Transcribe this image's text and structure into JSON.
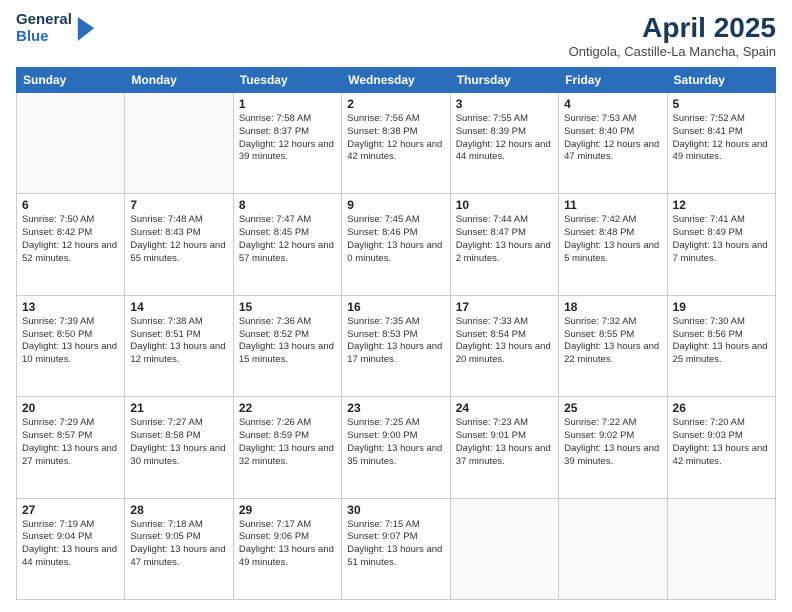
{
  "logo": {
    "line1": "General",
    "line2": "Blue"
  },
  "title": "April 2025",
  "subtitle": "Ontigola, Castille-La Mancha, Spain",
  "headers": [
    "Sunday",
    "Monday",
    "Tuesday",
    "Wednesday",
    "Thursday",
    "Friday",
    "Saturday"
  ],
  "weeks": [
    [
      {
        "day": "",
        "detail": ""
      },
      {
        "day": "",
        "detail": ""
      },
      {
        "day": "1",
        "detail": "Sunrise: 7:58 AM\nSunset: 8:37 PM\nDaylight: 12 hours and 39 minutes."
      },
      {
        "day": "2",
        "detail": "Sunrise: 7:56 AM\nSunset: 8:38 PM\nDaylight: 12 hours and 42 minutes."
      },
      {
        "day": "3",
        "detail": "Sunrise: 7:55 AM\nSunset: 8:39 PM\nDaylight: 12 hours and 44 minutes."
      },
      {
        "day": "4",
        "detail": "Sunrise: 7:53 AM\nSunset: 8:40 PM\nDaylight: 12 hours and 47 minutes."
      },
      {
        "day": "5",
        "detail": "Sunrise: 7:52 AM\nSunset: 8:41 PM\nDaylight: 12 hours and 49 minutes."
      }
    ],
    [
      {
        "day": "6",
        "detail": "Sunrise: 7:50 AM\nSunset: 8:42 PM\nDaylight: 12 hours and 52 minutes."
      },
      {
        "day": "7",
        "detail": "Sunrise: 7:48 AM\nSunset: 8:43 PM\nDaylight: 12 hours and 55 minutes."
      },
      {
        "day": "8",
        "detail": "Sunrise: 7:47 AM\nSunset: 8:45 PM\nDaylight: 12 hours and 57 minutes."
      },
      {
        "day": "9",
        "detail": "Sunrise: 7:45 AM\nSunset: 8:46 PM\nDaylight: 13 hours and 0 minutes."
      },
      {
        "day": "10",
        "detail": "Sunrise: 7:44 AM\nSunset: 8:47 PM\nDaylight: 13 hours and 2 minutes."
      },
      {
        "day": "11",
        "detail": "Sunrise: 7:42 AM\nSunset: 8:48 PM\nDaylight: 13 hours and 5 minutes."
      },
      {
        "day": "12",
        "detail": "Sunrise: 7:41 AM\nSunset: 8:49 PM\nDaylight: 13 hours and 7 minutes."
      }
    ],
    [
      {
        "day": "13",
        "detail": "Sunrise: 7:39 AM\nSunset: 8:50 PM\nDaylight: 13 hours and 10 minutes."
      },
      {
        "day": "14",
        "detail": "Sunrise: 7:38 AM\nSunset: 8:51 PM\nDaylight: 13 hours and 12 minutes."
      },
      {
        "day": "15",
        "detail": "Sunrise: 7:36 AM\nSunset: 8:52 PM\nDaylight: 13 hours and 15 minutes."
      },
      {
        "day": "16",
        "detail": "Sunrise: 7:35 AM\nSunset: 8:53 PM\nDaylight: 13 hours and 17 minutes."
      },
      {
        "day": "17",
        "detail": "Sunrise: 7:33 AM\nSunset: 8:54 PM\nDaylight: 13 hours and 20 minutes."
      },
      {
        "day": "18",
        "detail": "Sunrise: 7:32 AM\nSunset: 8:55 PM\nDaylight: 13 hours and 22 minutes."
      },
      {
        "day": "19",
        "detail": "Sunrise: 7:30 AM\nSunset: 8:56 PM\nDaylight: 13 hours and 25 minutes."
      }
    ],
    [
      {
        "day": "20",
        "detail": "Sunrise: 7:29 AM\nSunset: 8:57 PM\nDaylight: 13 hours and 27 minutes."
      },
      {
        "day": "21",
        "detail": "Sunrise: 7:27 AM\nSunset: 8:58 PM\nDaylight: 13 hours and 30 minutes."
      },
      {
        "day": "22",
        "detail": "Sunrise: 7:26 AM\nSunset: 8:59 PM\nDaylight: 13 hours and 32 minutes."
      },
      {
        "day": "23",
        "detail": "Sunrise: 7:25 AM\nSunset: 9:00 PM\nDaylight: 13 hours and 35 minutes."
      },
      {
        "day": "24",
        "detail": "Sunrise: 7:23 AM\nSunset: 9:01 PM\nDaylight: 13 hours and 37 minutes."
      },
      {
        "day": "25",
        "detail": "Sunrise: 7:22 AM\nSunset: 9:02 PM\nDaylight: 13 hours and 39 minutes."
      },
      {
        "day": "26",
        "detail": "Sunrise: 7:20 AM\nSunset: 9:03 PM\nDaylight: 13 hours and 42 minutes."
      }
    ],
    [
      {
        "day": "27",
        "detail": "Sunrise: 7:19 AM\nSunset: 9:04 PM\nDaylight: 13 hours and 44 minutes."
      },
      {
        "day": "28",
        "detail": "Sunrise: 7:18 AM\nSunset: 9:05 PM\nDaylight: 13 hours and 47 minutes."
      },
      {
        "day": "29",
        "detail": "Sunrise: 7:17 AM\nSunset: 9:06 PM\nDaylight: 13 hours and 49 minutes."
      },
      {
        "day": "30",
        "detail": "Sunrise: 7:15 AM\nSunset: 9:07 PM\nDaylight: 13 hours and 51 minutes."
      },
      {
        "day": "",
        "detail": ""
      },
      {
        "day": "",
        "detail": ""
      },
      {
        "day": "",
        "detail": ""
      }
    ]
  ]
}
